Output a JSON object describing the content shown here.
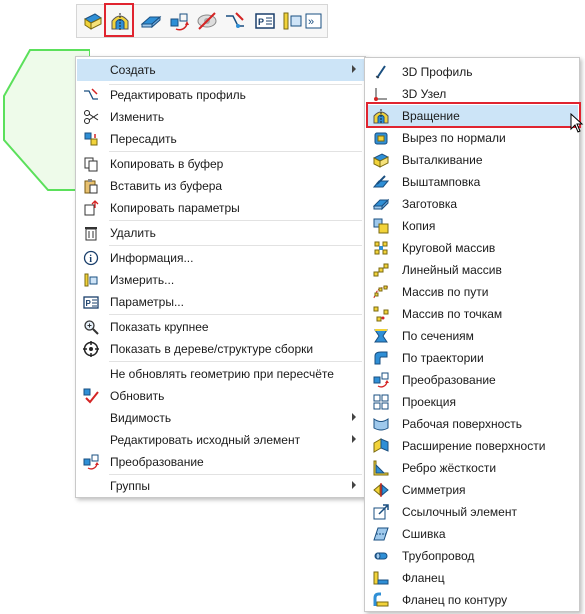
{
  "toolbar": {
    "buttons": [
      {
        "icon": "extrude-icon"
      },
      {
        "icon": "revolve-icon"
      },
      {
        "icon": "blank-icon"
      },
      {
        "icon": "transform-icon"
      },
      {
        "icon": "hide-icon"
      },
      {
        "icon": "edit-profile-icon"
      },
      {
        "icon": "parameters-icon"
      },
      {
        "icon": "measure-icon"
      },
      {
        "icon": "more-icon",
        "label": "»"
      }
    ],
    "highlighted_index": 1,
    "highlight_color": "#e0242f"
  },
  "context_menu": {
    "items": [
      {
        "label": "Создать",
        "icon": "",
        "submenu": true,
        "selected": true
      },
      {
        "label": "Редактировать профиль",
        "icon": "edit-profile-icon"
      },
      {
        "label": "Изменить",
        "icon": "scissors-icon"
      },
      {
        "label": "Пересадить",
        "icon": "reattach-icon"
      },
      {
        "label": "Копировать в буфер",
        "icon": "copy-icon"
      },
      {
        "label": "Вставить из буфера",
        "icon": "paste-icon"
      },
      {
        "label": "Копировать параметры",
        "icon": "copy-params-icon"
      },
      {
        "label": "Удалить",
        "icon": "trash-icon"
      },
      {
        "label": "Информация...",
        "icon": "info-icon"
      },
      {
        "label": "Измерить...",
        "icon": "measure-icon"
      },
      {
        "label": "Параметры...",
        "icon": "parameters-icon"
      },
      {
        "label": "Показать крупнее",
        "icon": "zoom-icon"
      },
      {
        "label": "Показать в дереве/структуре сборки",
        "icon": "crosshair-icon"
      },
      {
        "label": "Не обновлять геометрию при пересчёте",
        "icon": ""
      },
      {
        "label": "Обновить",
        "icon": "refresh-check-icon"
      },
      {
        "label": "Видимость",
        "icon": "",
        "submenu": true
      },
      {
        "label": "Редактировать исходный элемент",
        "icon": "",
        "submenu": true
      },
      {
        "label": "Преобразование",
        "icon": "transform-icon"
      },
      {
        "label": "Группы",
        "icon": "",
        "submenu": true
      }
    ]
  },
  "submenu": {
    "items": [
      {
        "label": "3D Профиль",
        "icon": "3d-profile-icon"
      },
      {
        "label": "3D Узел",
        "icon": "3d-node-icon"
      },
      {
        "label": "Вращение",
        "icon": "revolve-icon",
        "highlighted": true
      },
      {
        "label": "Вырез по нормали",
        "icon": "normal-cut-icon"
      },
      {
        "label": "Выталкивание",
        "icon": "extrude-icon"
      },
      {
        "label": "Выштамповка",
        "icon": "stamp-icon"
      },
      {
        "label": "Заготовка",
        "icon": "blank-icon"
      },
      {
        "label": "Копия",
        "icon": "copy-body-icon"
      },
      {
        "label": "Круговой массив",
        "icon": "circular-array-icon"
      },
      {
        "label": "Линейный массив",
        "icon": "linear-array-icon"
      },
      {
        "label": "Массив по пути",
        "icon": "path-array-icon"
      },
      {
        "label": "Массив по точкам",
        "icon": "point-array-icon"
      },
      {
        "label": "По сечениям",
        "icon": "loft-icon"
      },
      {
        "label": "По траектории",
        "icon": "sweep-icon"
      },
      {
        "label": "Преобразование",
        "icon": "transform-icon"
      },
      {
        "label": "Проекция",
        "icon": "projection-icon"
      },
      {
        "label": "Рабочая поверхность",
        "icon": "work-surface-icon"
      },
      {
        "label": "Расширение поверхности",
        "icon": "surface-extend-icon"
      },
      {
        "label": "Ребро жёсткости",
        "icon": "rib-icon"
      },
      {
        "label": "Симметрия",
        "icon": "symmetry-icon"
      },
      {
        "label": "Ссылочный элемент",
        "icon": "reference-icon"
      },
      {
        "label": "Сшивка",
        "icon": "stitch-icon"
      },
      {
        "label": "Трубопровод",
        "icon": "pipe-icon"
      },
      {
        "label": "Фланец",
        "icon": "flange-icon"
      },
      {
        "label": "Фланец по контуру",
        "icon": "contour-flange-icon"
      }
    ]
  },
  "colors": {
    "menu_selection": "#cce4f7",
    "highlight_box": "#e0242f",
    "shape_outline": "#5be05b",
    "shape_fill": "#eefbea"
  }
}
